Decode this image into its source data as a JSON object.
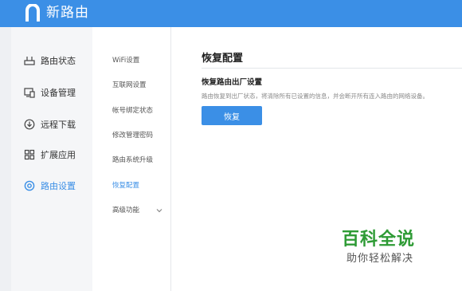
{
  "header": {
    "app_title": "新路由",
    "logo_icon": "router-n-logo"
  },
  "sidebar": {
    "items": [
      {
        "label": "路由状态",
        "icon": "router-status-icon",
        "active": false
      },
      {
        "label": "设备管理",
        "icon": "devices-icon",
        "active": false
      },
      {
        "label": "远程下载",
        "icon": "remote-download-icon",
        "active": false
      },
      {
        "label": "扩展应用",
        "icon": "apps-grid-icon",
        "active": false
      },
      {
        "label": "路由设置",
        "icon": "settings-icon",
        "active": true
      }
    ]
  },
  "subnav": {
    "items": [
      {
        "label": "WiFi设置"
      },
      {
        "label": "互联网设置"
      },
      {
        "label": "帐号绑定状态"
      },
      {
        "label": "修改管理密码"
      },
      {
        "label": "路由系统升级"
      },
      {
        "label": "恢复配置",
        "active": true
      },
      {
        "label": "高级功能",
        "expandable": true
      }
    ]
  },
  "main": {
    "title": "恢复配置",
    "section_title": "恢复路由出厂设置",
    "description": "路由恢复到出厂状态，将清除所有已设置的信息，并会断开所有连入路由的网络设备。",
    "restore_button": "恢复"
  },
  "watermark": {
    "title": "百科全说",
    "subtitle": "助你轻松解决"
  },
  "colors": {
    "accent": "#3b8fe6",
    "watermark_green": "#2e9b35"
  }
}
